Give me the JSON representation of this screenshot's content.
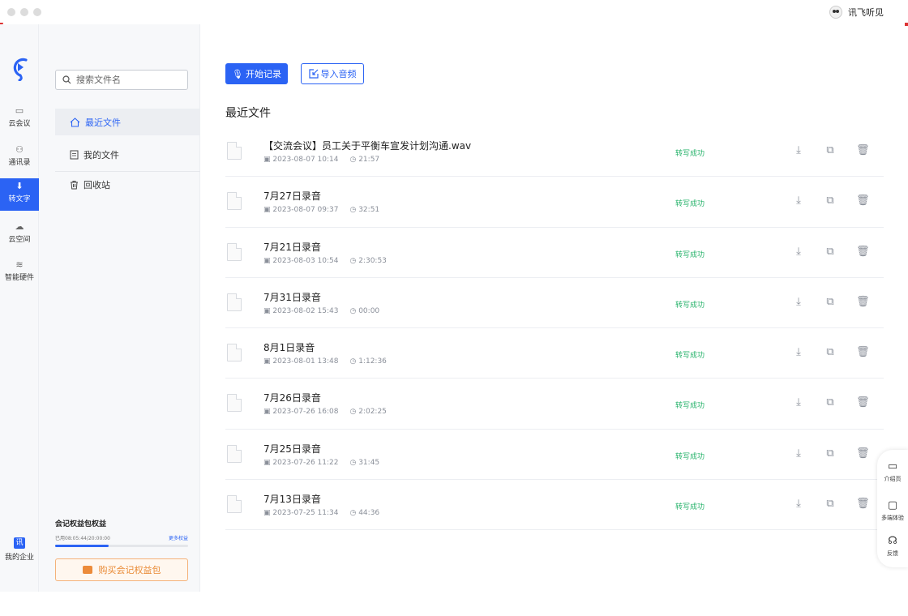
{
  "titlebar": {
    "user_name": "讯飞听见"
  },
  "rail": {
    "items": [
      {
        "label": "云会议",
        "icon": "video-icon"
      },
      {
        "label": "通讯录",
        "icon": "contacts-icon"
      },
      {
        "label": "转文字",
        "icon": "mic-icon",
        "active": true
      },
      {
        "label": "云空间",
        "icon": "cloud-icon"
      },
      {
        "label": "智能硬件",
        "icon": "layers-icon"
      }
    ],
    "enterprise": {
      "badge": "讯",
      "label": "我的企业"
    }
  },
  "panel": {
    "search_placeholder": "搜索文件名",
    "nav": [
      {
        "label": "最近文件",
        "icon": "home-icon"
      },
      {
        "label": "我的文件",
        "icon": "document-icon"
      },
      {
        "label": "回收站",
        "icon": "trash-icon"
      }
    ],
    "quota": {
      "title": "会记权益包权益",
      "used_text": "已用08:05:44/20:00:00",
      "more_link": "更多权益",
      "used_fraction": 0.4
    },
    "buy_button": "购买会记权益包"
  },
  "main": {
    "start_button": "开始记录",
    "import_button": "导入音频",
    "section_title": "最近文件",
    "files": [
      {
        "name": "【交流会议】员工关于平衡车宣发计划沟通.wav",
        "date": "2023-08-07 10:14",
        "duration": "21:57",
        "status": "转写成功"
      },
      {
        "name": "7月27日录音",
        "date": "2023-08-07 09:37",
        "duration": "32:51",
        "status": "转写成功"
      },
      {
        "name": "7月21日录音",
        "date": "2023-08-03 10:54",
        "duration": "2:30:53",
        "status": "转写成功"
      },
      {
        "name": "7月31日录音",
        "date": "2023-08-02 15:43",
        "duration": "00:00",
        "status": "转写成功"
      },
      {
        "name": "8月1日录音",
        "date": "2023-08-01 13:48",
        "duration": "1:12:36",
        "status": "转写成功"
      },
      {
        "name": "7月26日录音",
        "date": "2023-07-26 16:08",
        "duration": "2:02:25",
        "status": "转写成功"
      },
      {
        "name": "7月25日录音",
        "date": "2023-07-26 11:22",
        "duration": "31:45",
        "status": "转写成功"
      },
      {
        "name": "7月13日录音",
        "date": "2023-07-25 11:34",
        "duration": "44:36",
        "status": "转写成功"
      }
    ]
  },
  "float_bar": [
    {
      "label": "介绍页",
      "icon": "card-icon"
    },
    {
      "label": "多端体验",
      "icon": "monitor-icon"
    },
    {
      "label": "反馈",
      "icon": "headset-icon"
    }
  ],
  "colors": {
    "accent": "#2b63f4",
    "success": "#27b36b",
    "buy": "#e98a35"
  }
}
